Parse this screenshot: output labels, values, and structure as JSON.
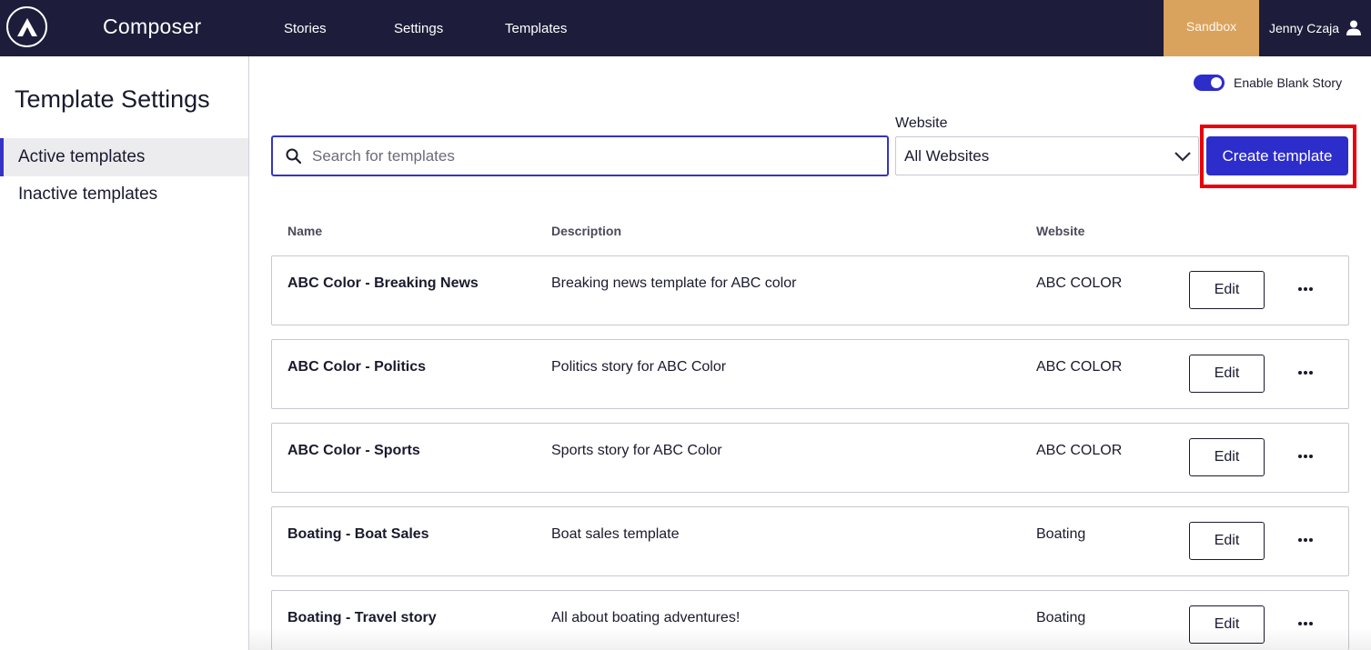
{
  "header": {
    "app_title": "Composer",
    "logo_icon": "logo-icon",
    "nav": [
      {
        "label": "Stories"
      },
      {
        "label": "Settings"
      },
      {
        "label": "Templates"
      }
    ],
    "environment_badge": "Sandbox",
    "user_name": "Jenny Czaja",
    "colors": {
      "background": "#1d1d3b",
      "badge": "#d9a35e"
    }
  },
  "sidebar": {
    "title": "Template Settings",
    "items": [
      {
        "label": "Active templates",
        "active": true
      },
      {
        "label": "Inactive templates",
        "active": false
      }
    ]
  },
  "toolbar": {
    "blank_story_toggle_label": "Enable Blank Story",
    "blank_story_enabled": true,
    "search_placeholder": "Search for templates",
    "search_value": "",
    "website_label": "Website",
    "website_selected": "All Websites",
    "create_button_label": "Create template",
    "accent_color": "#2d2dcc"
  },
  "table": {
    "columns": [
      "Name",
      "Description",
      "Website"
    ],
    "rows": [
      {
        "name": "ABC Color - Breaking News",
        "description": "Breaking news template for ABC color",
        "website": "ABC COLOR",
        "edit_label": "Edit"
      },
      {
        "name": "ABC Color - Politics",
        "description": "Politics story for ABC Color",
        "website": "ABC COLOR",
        "edit_label": "Edit"
      },
      {
        "name": "ABC Color - Sports",
        "description": "Sports story for ABC Color",
        "website": "ABC COLOR",
        "edit_label": "Edit"
      },
      {
        "name": "Boating - Boat Sales",
        "description": "Boat sales template",
        "website": "Boating",
        "edit_label": "Edit"
      },
      {
        "name": "Boating - Travel story",
        "description": "All about boating adventures!",
        "website": "Boating",
        "edit_label": "Edit"
      }
    ]
  }
}
